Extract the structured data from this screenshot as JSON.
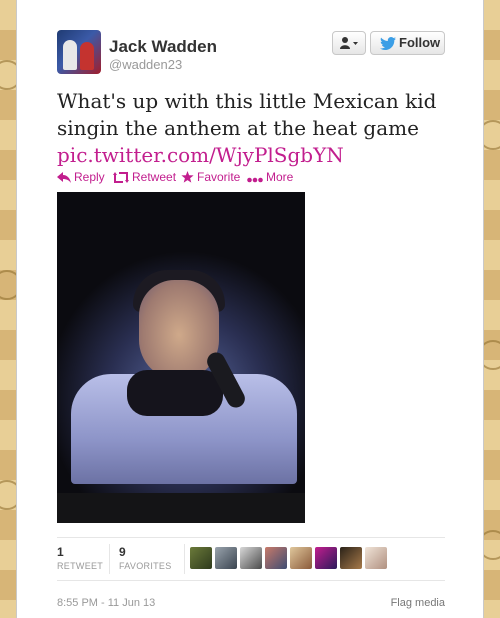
{
  "tweet": {
    "author_name": "Jack Wadden",
    "author_handle": "@wadden23",
    "text": "What's up with this little Mexican kid singin the anthem at the heat game",
    "link": "pic.twitter.com/WjyPlSgbYN",
    "timestamp": "8:55 PM - 11 Jun 13"
  },
  "buttons": {
    "user_menu_icon": "user-icon",
    "follow_label": "Follow"
  },
  "actions": [
    {
      "label": "Reply",
      "icon": "reply-icon"
    },
    {
      "label": "Retweet",
      "icon": "retweet-icon"
    },
    {
      "label": "Favorite",
      "icon": "star-icon"
    },
    {
      "label": "More",
      "icon": "more-icon"
    }
  ],
  "stats": {
    "retweets_count": "1",
    "retweets_label": "RETWEET",
    "favorites_count": "9",
    "favorites_label": "FAVORITES"
  },
  "footer": {
    "flag_label": "Flag media"
  },
  "colors": {
    "accent": "#c21e8e",
    "twitter_blue": "#3b9ee6"
  }
}
